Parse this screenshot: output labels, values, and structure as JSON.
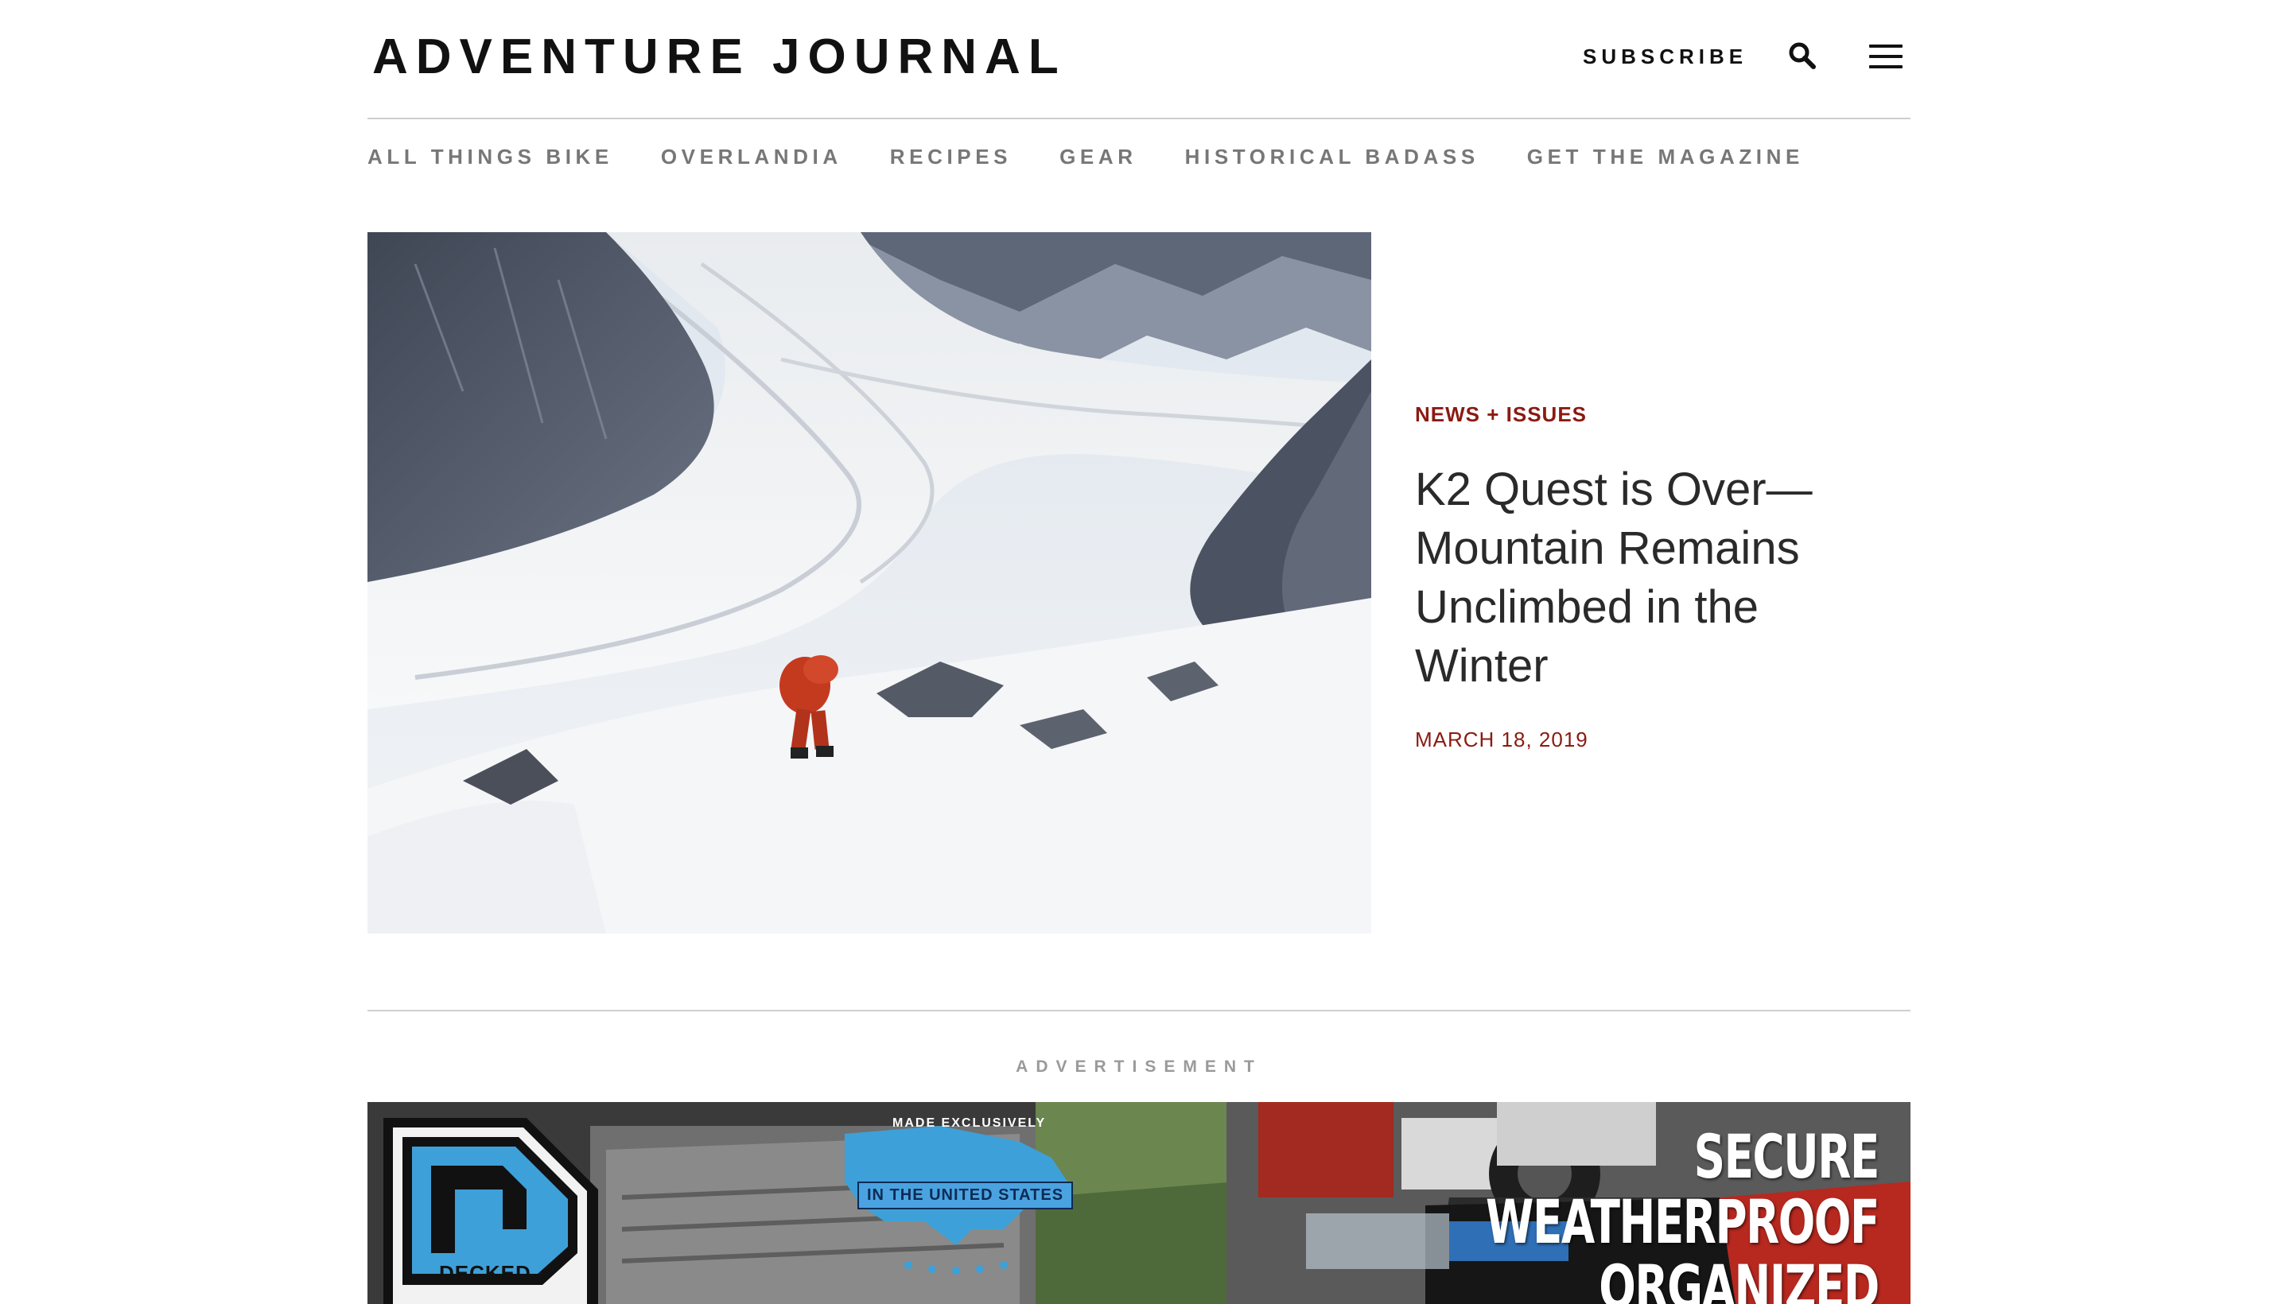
{
  "header": {
    "logo": "ADVENTURE JOURNAL",
    "subscribe_label": "SUBSCRIBE",
    "search_icon": "search-icon",
    "menu_icon": "hamburger-menu-icon"
  },
  "nav": {
    "items": [
      {
        "label": "ALL THINGS BIKE"
      },
      {
        "label": "OVERLANDIA"
      },
      {
        "label": "RECIPES"
      },
      {
        "label": "GEAR"
      },
      {
        "label": "HISTORICAL BADASS"
      },
      {
        "label": "GET THE MAGAZINE"
      }
    ]
  },
  "feature": {
    "category": "NEWS + ISSUES",
    "headline": "K2 Quest is Over—Mountain Remains Unclimbed in the Winter",
    "date": "MARCH 18, 2019"
  },
  "ad": {
    "label": "ADVERTISEMENT",
    "brand": "DECKED",
    "made_top": "MADE EXCLUSIVELY",
    "made_bottom": "IN THE UNITED STATES",
    "headline_lines": [
      "SECURE",
      "WEATHERPROOF",
      "ORGANIZED"
    ]
  },
  "colors": {
    "accent": "#8b1a12",
    "nav_text": "#777777",
    "rule": "#cfcfcf"
  }
}
